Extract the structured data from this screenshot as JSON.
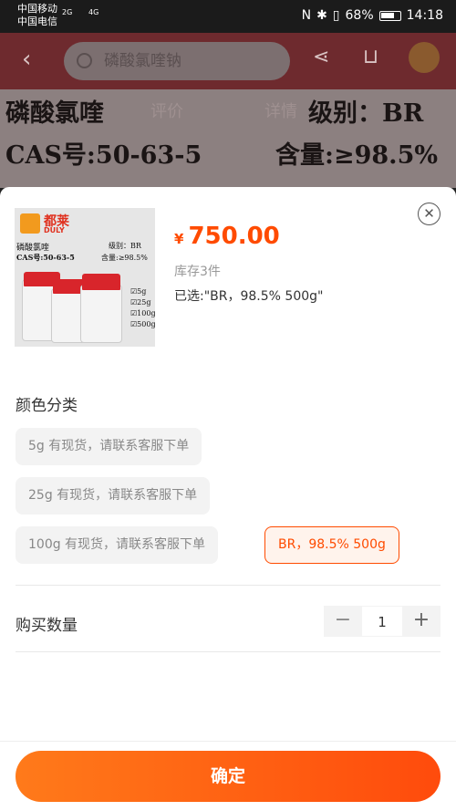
{
  "status_bar": {
    "carrier1": "中国移动",
    "carrier2": "中国电信",
    "net1": "2G",
    "net2": "4G",
    "battery_percent": "68%",
    "time": "14:18"
  },
  "background_page": {
    "search_placeholder": "磷酸氯喹钠",
    "banner_line1": "磷酸氯喹",
    "tab_reviews": "评价",
    "tab_details": "详情",
    "banner_grade": "级别：BR",
    "banner_cas": "CAS号:50-63-5",
    "banner_content": "含量:≥98.5%"
  },
  "product": {
    "image": {
      "brand": "都莱",
      "brand_en": "DULY",
      "name": "磷酸氯喹",
      "grade": "级别：BR",
      "cas": "CAS号:50-63-5",
      "content": "含量:≥98.5%",
      "sizes": [
        "☑5g",
        "☑25g",
        "☑100g",
        "☑500g"
      ]
    },
    "currency": "¥",
    "price": "750.00",
    "stock": "库存3件",
    "selected": "已选:\"BR，98.5%  500g\""
  },
  "variants": {
    "title": "颜色分类",
    "options": [
      {
        "label": "5g  有现货，请联系客服下单",
        "active": false
      },
      {
        "label": "25g  有现货，请联系客服下单",
        "active": false
      },
      {
        "label": "100g  有现货，请联系客服下单",
        "active": false
      },
      {
        "label": "BR，98.5%  500g",
        "active": true
      }
    ]
  },
  "quantity": {
    "label": "购买数量",
    "value": "1",
    "minus": "−",
    "plus": "+"
  },
  "confirm_button": "确定",
  "colors": {
    "accent": "#ff4b00",
    "button_gradient_start": "#ff7a1a",
    "button_gradient_end": "#ff4b0c"
  }
}
